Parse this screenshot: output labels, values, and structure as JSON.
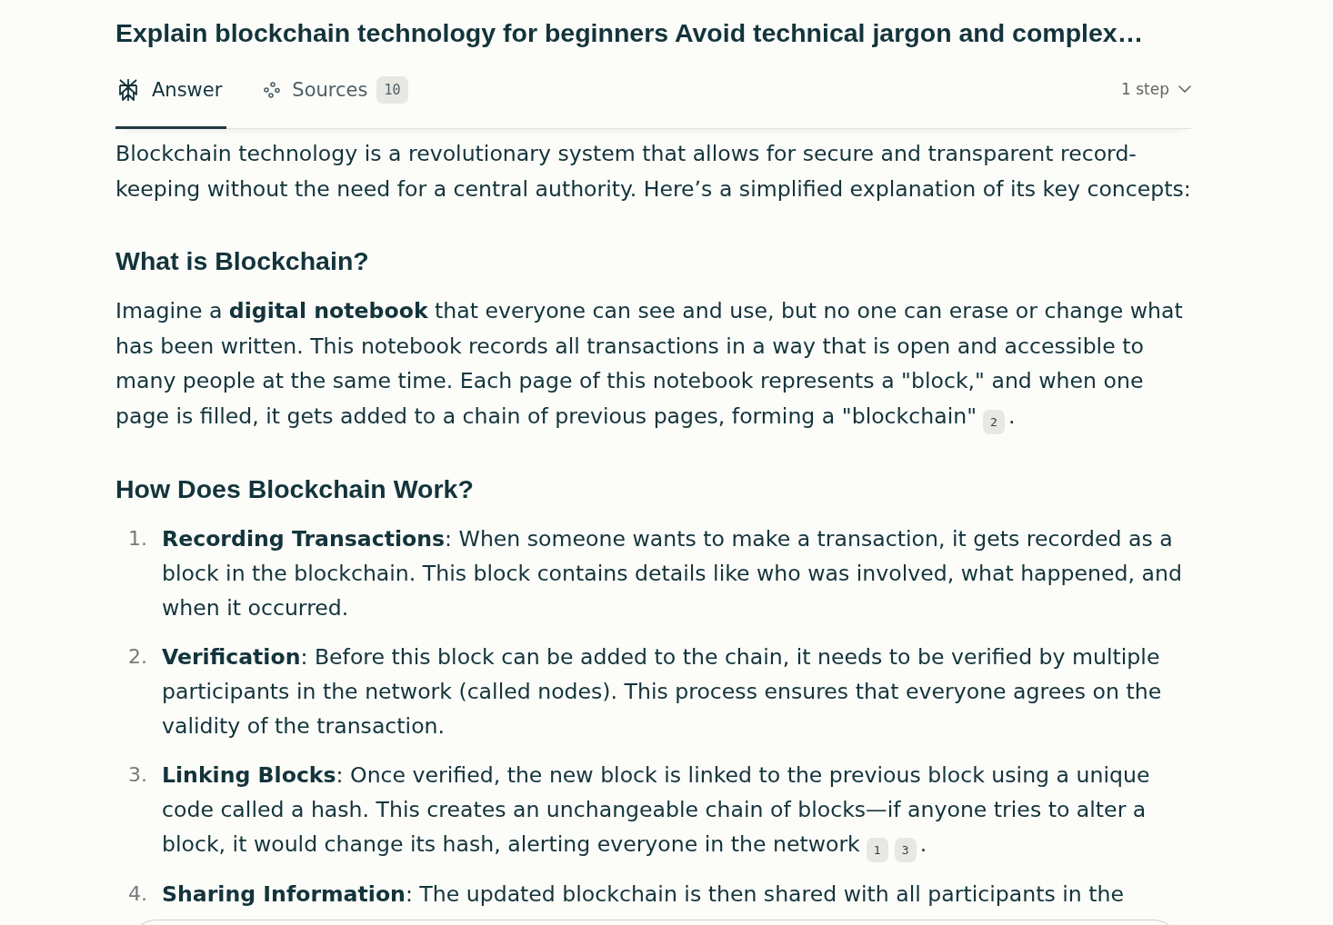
{
  "title": "Explain blockchain technology for beginners Avoid technical jargon and complex…",
  "tabs": [
    {
      "kind": "answer",
      "label": "Answer",
      "selected": true
    },
    {
      "kind": "sources",
      "label": "Sources",
      "count": "10",
      "selected": false
    }
  ],
  "steps_toggle": {
    "label": "1 step"
  },
  "answer": [
    {
      "kind": "paragraph",
      "text": "Blockchain technology is a revolutionary system that allows for secure and transparent record-keeping without the need for a central authority. Here’s a simplified explanation of its key concepts:"
    },
    {
      "kind": "heading",
      "text": "What is Blockchain?"
    },
    {
      "kind": "paragraph",
      "text": "Imagine a **digital notebook** that everyone can see and use, but no one can erase or change what has been written. This notebook records all transactions in a way that is open and accessible to many people at the same time. Each page of this notebook represents a \"block,\" and when one page is filled, it gets added to a chain of previous pages, forming a \"blockchain\"",
      "citations": [
        "2"
      ],
      "tail": "."
    },
    {
      "kind": "heading",
      "text": "How Does Blockchain Work?"
    },
    {
      "kind": "list",
      "items": [
        {
          "number": "1.",
          "text": "**Recording Transactions**: When someone wants to make a transaction, it gets recorded as a block in the blockchain. This block contains details like who was involved, what happened, and when it occurred."
        },
        {
          "number": "2.",
          "text": "**Verification**: Before this block can be added to the chain, it needs to be verified by multiple participants in the network (called nodes). This process ensures that everyone agrees on the validity of the transaction."
        },
        {
          "number": "3.",
          "text": "**Linking Blocks**: Once verified, the new block is linked to the previous block using a unique code called a hash. This creates an unchangeable chain of blocks—if anyone tries to alter a block, it would change its hash, alerting everyone in the network",
          "citations": [
            "1",
            "3"
          ],
          "tail": "."
        },
        {
          "number": "4.",
          "text": "**Sharing Information**: The updated blockchain is then shared with all participants in the"
        }
      ]
    }
  ]
}
